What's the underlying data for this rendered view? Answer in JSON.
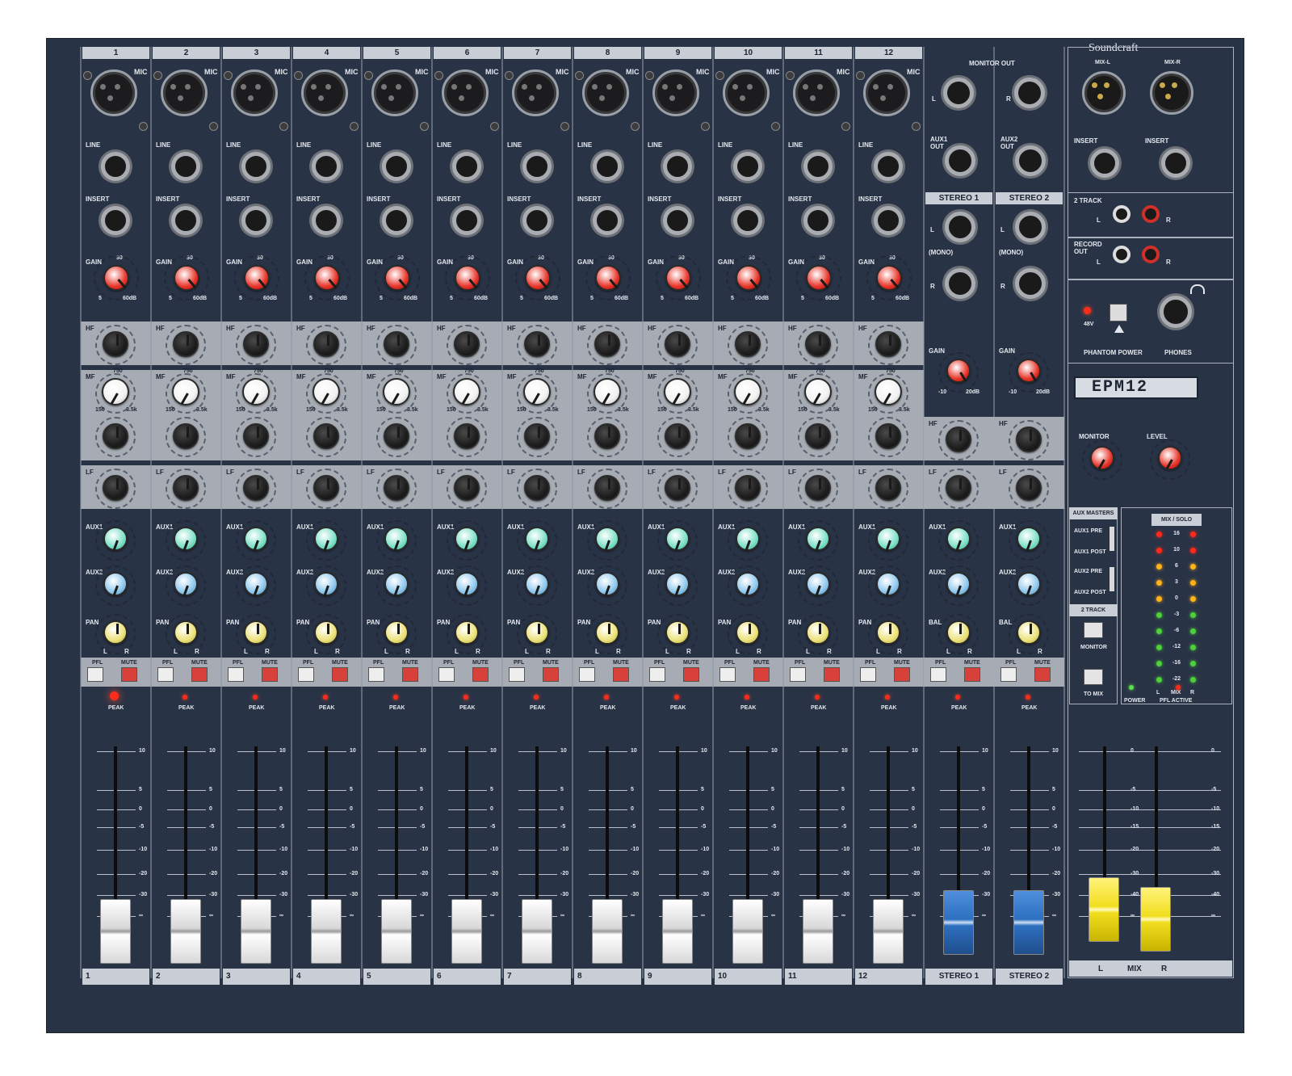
{
  "brand": "Soundcraft",
  "model": "EPM12",
  "channels": [
    {
      "number": "1",
      "bottom": "1"
    },
    {
      "number": "2",
      "bottom": "2"
    },
    {
      "number": "3",
      "bottom": "3"
    },
    {
      "number": "4",
      "bottom": "4"
    },
    {
      "number": "5",
      "bottom": "5"
    },
    {
      "number": "6",
      "bottom": "6"
    },
    {
      "number": "7",
      "bottom": "7"
    },
    {
      "number": "8",
      "bottom": "8"
    },
    {
      "number": "9",
      "bottom": "9"
    },
    {
      "number": "10",
      "bottom": "10"
    },
    {
      "number": "11",
      "bottom": "11"
    },
    {
      "number": "12",
      "bottom": "12"
    }
  ],
  "channel_labels": {
    "mic": "MIC",
    "line": "LINE",
    "insert": "INSERT",
    "gain": "GAIN",
    "gain_min": "5",
    "gain_mid": "30",
    "gain_max": "60dB",
    "hf": "HF",
    "mf": "MF",
    "lf": "LF",
    "mf_min": "150",
    "mf_mid": "750",
    "mf_max": "3.5k",
    "aux1": "AUX1",
    "aux2": "AUX2",
    "pan": "PAN",
    "pan_l": "L",
    "pan_r": "R",
    "pfl": "PFL",
    "mute": "MUTE",
    "peak": "PEAK"
  },
  "stereo_channels": [
    {
      "name": "STEREO 1",
      "aux_out": "AUX1\nOUT",
      "bottom": "STEREO 1"
    },
    {
      "name": "STEREO 2",
      "aux_out": "AUX2\nOUT",
      "bottom": "STEREO 2"
    }
  ],
  "stereo_labels": {
    "monitor_out": "MONITOR OUT",
    "l": "L",
    "r": "R",
    "mono": "(MONO)",
    "gain": "GAIN",
    "gain_min": "-10",
    "gain_max": "20dB",
    "bal": "BAL"
  },
  "master": {
    "mix_l": "MIX-L",
    "mix_r": "MIX-R",
    "insert": "INSERT",
    "two_track": "2 TRACK",
    "record_out": "RECORD\nOUT",
    "v48": "48V",
    "phantom_power": "PHANTOM POWER",
    "phones": "PHONES",
    "monitor": "MONITOR",
    "level": "LEVEL",
    "aux_masters": "AUX MASTERS",
    "aux1_pre": "AUX1 PRE",
    "aux1_post": "AUX1 POST",
    "aux2_pre": "AUX2 PRE",
    "aux2_post": "AUX2 POST",
    "two_track_panel": "2 TRACK",
    "monitor_btn": "MONITOR",
    "to_mix": "TO MIX",
    "mix_solo": "MIX / SOLO",
    "meter_l": "L",
    "meter_mix": "MIX",
    "meter_r": "R",
    "power": "POWER",
    "pfl_active": "PFL ACTIVE",
    "bottom_l": "L",
    "bottom_mix": "MIX",
    "bottom_r": "R"
  },
  "meter_scale": [
    "16",
    "10",
    "6",
    "3",
    "0",
    "-3",
    "-6",
    "-12",
    "-16",
    "-22"
  ],
  "fader_scale": [
    "10",
    "5",
    "0",
    "-5",
    "-10",
    "-20",
    "-30",
    "∞"
  ],
  "master_fader_scale": [
    "0",
    "-5",
    "-10",
    "-15",
    "-20",
    "-30",
    "-40",
    "∞"
  ],
  "colors": {
    "panel": "#293346",
    "gain_knob": "#e8372c",
    "aux1_knob": "#7de0c8",
    "aux2_knob": "#8fc8ee",
    "pan_knob": "#ece27a",
    "mute": "#d8403a",
    "stereo_fader": "#2d6fc0",
    "master_fader": "#f2de1e"
  }
}
